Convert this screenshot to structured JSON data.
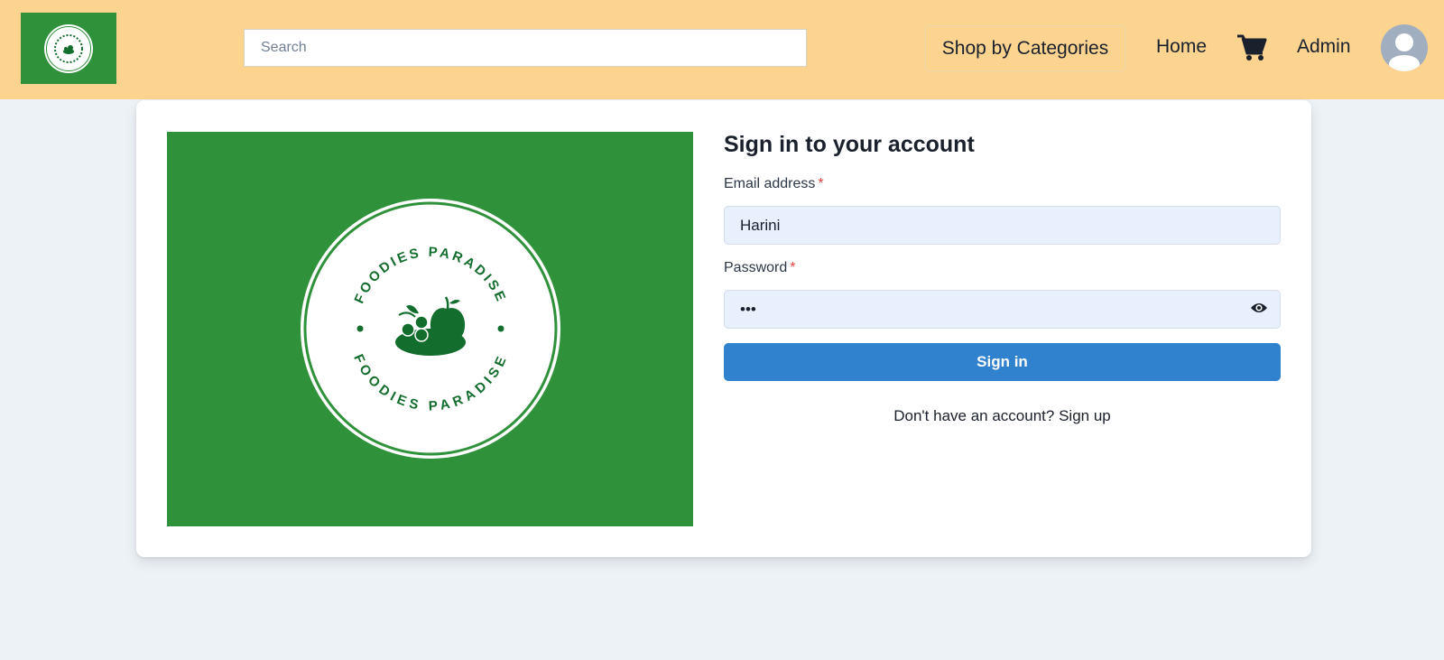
{
  "header": {
    "logo_alt": "Foodies Paradise logo",
    "search": {
      "placeholder": "Search",
      "value": ""
    },
    "nav": {
      "shop_by_categories": "Shop by Categories",
      "home": "Home",
      "admin": "Admin"
    },
    "cart_icon": "shopping-cart-icon",
    "avatar_icon": "user-avatar-icon"
  },
  "hero": {
    "brand_text": "FOODIES PARADISE",
    "background_color": "#2f913a"
  },
  "login": {
    "title": "Sign in to your account",
    "email_label": "Email address",
    "email_value": "Harini",
    "password_label": "Password",
    "password_value": "abc",
    "required_mark": "*",
    "submit_label": "Sign in",
    "no_account_text": "Don't have an account?",
    "signup_link": "Sign up"
  },
  "colors": {
    "header_bg": "#fcd490",
    "page_bg": "#edf2f7",
    "primary": "#3182ce",
    "brand_green": "#2f913a",
    "dark_green": "#136d2c"
  }
}
